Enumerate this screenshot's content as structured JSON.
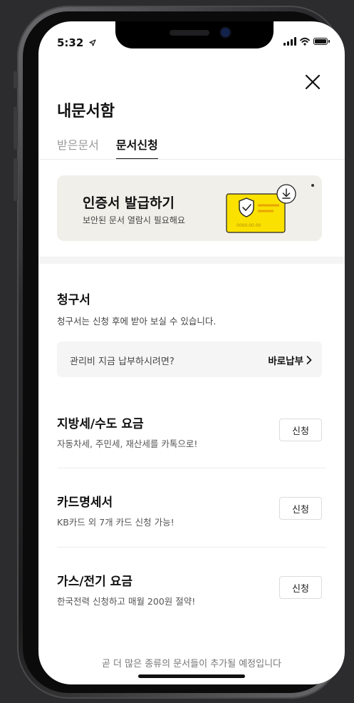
{
  "status_bar": {
    "time": "5:32"
  },
  "header": {
    "title": "내문서함"
  },
  "tabs": [
    {
      "label": "받은문서",
      "active": false
    },
    {
      "label": "문서신청",
      "active": true
    }
  ],
  "cert_banner": {
    "title": "인증서 발급하기",
    "subtitle": "보안된 문서 열람시 필요해요",
    "card_number": "0000.00.00"
  },
  "billing": {
    "title": "청구서",
    "description": "청구서는 신청 후에 받아 보실 수 있습니다.",
    "pay_prompt": "관리비 지금 납부하시려면?",
    "pay_link": "바로납부"
  },
  "services": [
    {
      "title": "지방세/수도 요금",
      "description": "자동차세, 주민세, 재산세를 카톡으로!",
      "button": "신청"
    },
    {
      "title": "카드명세서",
      "description": "KB카드 외 7개 카드 신청 가능!",
      "button": "신청"
    },
    {
      "title": "가스/전기 요금",
      "description": "한국전력 신청하고 매월 200원 절약!",
      "button": "신청"
    }
  ],
  "footer": {
    "note": "곧 더 많은 종류의 문서들이 추가될 예정입니다"
  },
  "colors": {
    "accent_yellow": "#fae100",
    "banner_bg": "#f1efe9",
    "text": "#111111"
  }
}
